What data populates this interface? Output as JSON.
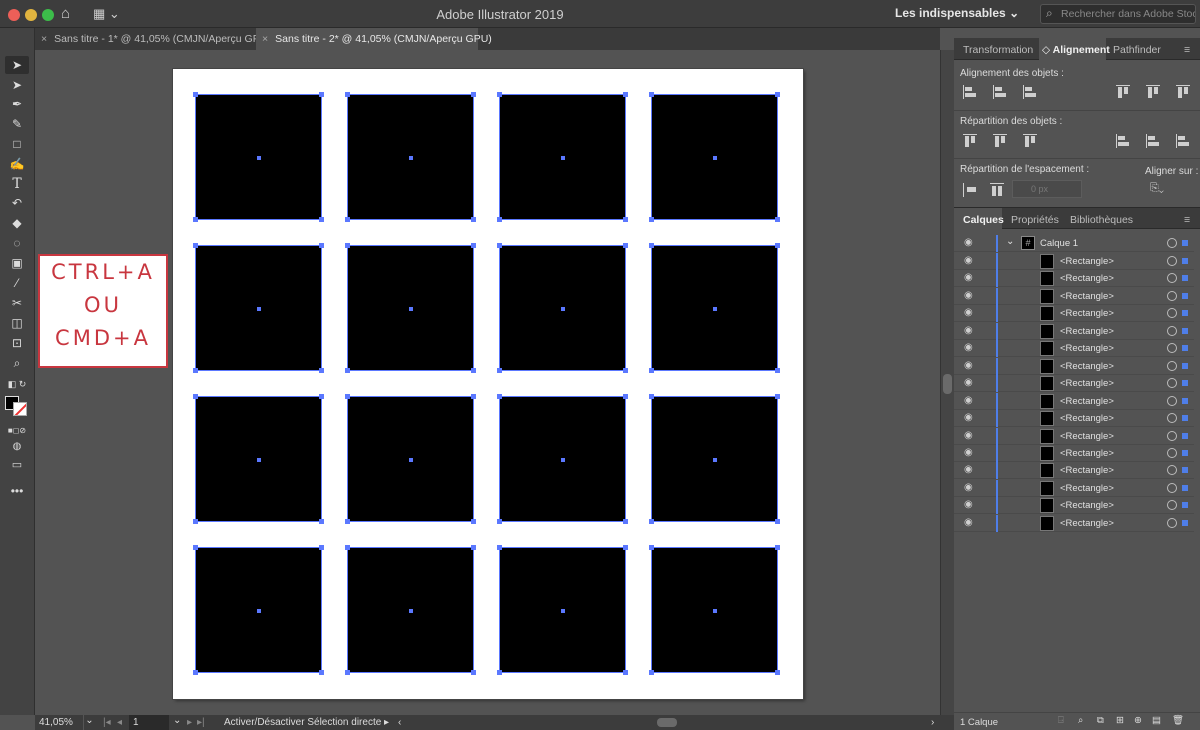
{
  "window": {
    "title": "Adobe Illustrator 2019",
    "workspace": "Les indispensables",
    "search_placeholder": "Rechercher dans Adobe Stock"
  },
  "icons": {
    "home": "home-icon",
    "arrange": "arrange-documents-icon",
    "search": "search-icon",
    "menu": "panel-menu-icon"
  },
  "colors": {
    "selection": "#5b78ff",
    "callout": "#c8363f",
    "panel_bg": "#535353",
    "chrome": "#3d3d3d"
  },
  "tabs": [
    {
      "label": "Sans titre - 1* @ 41,05% (CMJN/Aperçu GPU)",
      "close": "×"
    },
    {
      "label": "Sans titre - 2* @ 41,05% (CMJN/Aperçu GPU)",
      "close": "×"
    }
  ],
  "callout": {
    "line1": "CTRL+A",
    "line2": "OU",
    "line3": "CMD+A"
  },
  "artboard": {
    "rows": 4,
    "cols": 4,
    "fill": "#000000"
  },
  "status": {
    "zoom": "41,05%",
    "page": "1",
    "tool_status": "Activer/Désactiver Sélection directe"
  },
  "align_panel": {
    "tabs": [
      "Transformation",
      "Alignement",
      "Pathfinder"
    ],
    "align_objects": "Alignement des objets :",
    "distribute_objects": "Répartition des objets :",
    "distribute_spacing": "Répartition de l'espacement :",
    "align_to": "Aligner sur :",
    "spacing_value": "0 px"
  },
  "layers_panel": {
    "tabs": [
      "Calques",
      "Propriétés",
      "Bibliothèques"
    ],
    "layer_name": "Calque 1",
    "items": [
      "<Rectangle>",
      "<Rectangle>",
      "<Rectangle>",
      "<Rectangle>",
      "<Rectangle>",
      "<Rectangle>",
      "<Rectangle>",
      "<Rectangle>",
      "<Rectangle>",
      "<Rectangle>",
      "<Rectangle>",
      "<Rectangle>",
      "<Rectangle>",
      "<Rectangle>",
      "<Rectangle>",
      "<Rectangle>"
    ],
    "footer_count": "1 Calque"
  }
}
